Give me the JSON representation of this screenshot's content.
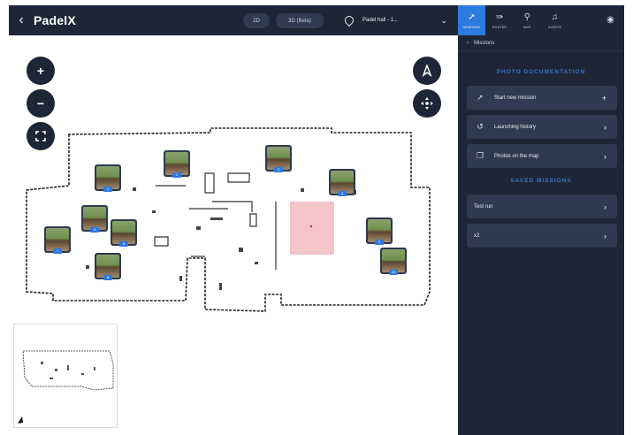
{
  "header": {
    "title": "PadelX",
    "view_2d": "2D",
    "view_3d": "3D (Beta)",
    "robot_name": "Padel hall - 1..."
  },
  "nav": {
    "tabs": [
      {
        "label": "MISSIONS",
        "icon": "rocket-icon",
        "active": true
      },
      {
        "label": "ROUTES",
        "icon": "route-icon",
        "active": false
      },
      {
        "label": "MAP",
        "icon": "map-pin-icon",
        "active": false
      },
      {
        "label": "ALERTS",
        "icon": "bell-icon",
        "active": false
      }
    ],
    "profile_icon": "user-circle-icon"
  },
  "panel": {
    "back_label": "Missions",
    "section_photo": "PHOTO DOCUMENTATION",
    "start_new": "Start new mission",
    "launching_history": "Launching history",
    "photos_on_map": "Photos on the map",
    "section_saved": "SAVED MISSIONS",
    "saved": [
      "Test run",
      "x2"
    ]
  },
  "map": {
    "markers": [
      "1",
      "2",
      "3",
      "4",
      "5",
      "6",
      "7",
      "8",
      "9",
      "10"
    ],
    "zone_color": "#f4c4c8"
  },
  "colors": {
    "dark": "#1d2637",
    "accent": "#2d7be0",
    "panel_row": "#2e3a4f"
  }
}
